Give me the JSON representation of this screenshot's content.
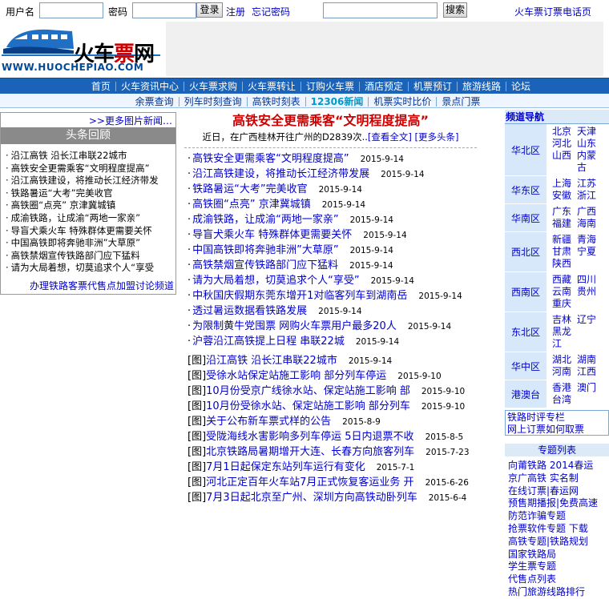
{
  "login": {
    "username_label": "用户名",
    "password_label": "密码",
    "login_button": "登录",
    "register": "注册",
    "forgot": "忘记密码",
    "search_button": "搜索",
    "hotline": "火车票订票电话页"
  },
  "logo": {
    "name_black": "火车",
    "name_red": "票",
    "name_black2": "网",
    "url": "WWW.HUOCHEPIAO.COM"
  },
  "nav_main": [
    "首页",
    "火车资讯中心",
    "火车票求购",
    "火车票转让",
    "订购火车票",
    "酒店预定",
    "机票预订",
    "旅游线路",
    "论坛"
  ],
  "nav_sub": [
    "余票查询",
    "列车时刻查询",
    "高铁时刻表",
    "12306新闻",
    "机票实时比价",
    "景点门票"
  ],
  "left": {
    "more_pics": ">>更多图片新闻…",
    "title": "头条回顾",
    "items": [
      "沿江高铁 沿长江串联22城市",
      "高铁安全更需乘客“文明程度提高”",
      "沿江高铁建设，将推动长江经济带发",
      "铁路暑运“大考”完美收官",
      "高铁圈“点亮” 京津冀城镇",
      "成渝铁路，让成渝“两地一家亲”",
      "导盲犬乘火车 特殊群体更需要关怀",
      "中国高铁即将奔驰非洲”大草原”",
      "高铁禁烟宣传铁路部门应下猛料",
      "请为大局着想，切莫追求个人“享受"
    ],
    "footer": "办理铁路客票代售点加盟讨论频道"
  },
  "headline": {
    "title": "高铁安全更需乘客“文明程度提高”",
    "summary": "近日，在广西桂林开往广州的D2839次..",
    "full": "[查看全文]",
    "more": "[更多头条]"
  },
  "news": [
    {
      "title": "高铁安全更需乘客“文明程度提高”",
      "date": "2015-9-14"
    },
    {
      "title": "沿江高铁建设，将推动长江经济带发展",
      "date": "2015-9-14"
    },
    {
      "title": "铁路暑运“大考”完美收官",
      "date": "2015-9-14"
    },
    {
      "title": "高铁圈“点亮” 京津冀城镇",
      "date": "2015-9-14"
    },
    {
      "title": "成渝铁路，让成渝“两地一家亲”",
      "date": "2015-9-14"
    },
    {
      "title": "导盲犬乘火车 特殊群体更需要关怀",
      "date": "2015-9-14"
    },
    {
      "title": "中国高铁即将奔驰非洲”大草原”",
      "date": "2015-9-14"
    },
    {
      "title": "高铁禁烟宣传铁路部门应下猛料",
      "date": "2015-9-14"
    },
    {
      "title": "请为大局着想，切莫追求个人“享受”",
      "date": "2015-9-14"
    },
    {
      "title": "中秋国庆假期东莞东增开1对临客列车到湖南岳",
      "date": "2015-9-14"
    },
    {
      "title": "透过暑运数据看铁路发展",
      "date": "2015-9-14"
    },
    {
      "title": "为限制黄牛党囤票 网购火车票用户最多20人",
      "date": "2015-9-14"
    },
    {
      "title": "沪蓉沿江高铁提上日程 串联22城",
      "date": "2015-9-14"
    }
  ],
  "pic_news_prefix": "[图]",
  "pic_news": [
    {
      "title": "沿江高铁 沿长江串联22城市",
      "date": "2015-9-14"
    },
    {
      "title": "受徐水站保定站施工影响 部分列车停运",
      "date": "2015-9-10"
    },
    {
      "title": "10月份受京广线徐水站、保定站施工影响 部",
      "date": "2015-9-10"
    },
    {
      "title": "10月份受徐水站、保定站施工影响 部分列车",
      "date": "2015-9-10"
    },
    {
      "title": "关于公布新车票式样的公告",
      "date": "2015-8-9"
    },
    {
      "title": "受陇海线水害影响多列车停运 5日内退票不收",
      "date": "2015-8-5"
    },
    {
      "title": "北京铁路局暑期增开大连、长春方向旅客列车",
      "date": "2015-7-23"
    },
    {
      "title": "7月1日起保定东站列车运行有变化",
      "date": "2015-7-1"
    },
    {
      "title": "河北正定百年火车站7月正式恢复客运业务 开",
      "date": "2015-6-26"
    },
    {
      "title": "7月3日起北京至广州、深圳方向高铁动卧列车",
      "date": "2015-6-4"
    }
  ],
  "channel": {
    "title": "频道导航",
    "regions": [
      {
        "name": "华北区",
        "cities": [
          "北京",
          "天津",
          "河北",
          "山东",
          "山西",
          "内蒙古"
        ]
      },
      {
        "name": "华东区",
        "cities": [
          "上海",
          "江苏",
          "安徽",
          "浙江"
        ]
      },
      {
        "name": "华南区",
        "cities": [
          "广东",
          "广西",
          "福建",
          "海南"
        ]
      },
      {
        "name": "西北区",
        "cities": [
          "新疆",
          "青海",
          "甘肃",
          "宁夏",
          "陕西"
        ]
      },
      {
        "name": "西南区",
        "cities": [
          "西藏",
          "四川",
          "云南",
          "贵州",
          "重庆"
        ]
      },
      {
        "name": "东北区",
        "cities": [
          "吉林",
          "辽宁",
          "黑龙江"
        ]
      },
      {
        "name": "华中区",
        "cities": [
          "湖北",
          "湖南",
          "河南",
          "江西"
        ]
      },
      {
        "name": "港澳台",
        "cities": [
          "香港",
          "澳门",
          "台湾"
        ]
      }
    ],
    "links": [
      "铁路时评专栏",
      "网上订票如何取票"
    ]
  },
  "topics": {
    "title": "专题列表",
    "items": [
      "向莆铁路 2014春运",
      "京广高铁 实名制",
      "在线订票|春运网",
      "预售期播报|免费高速",
      "防范诈骗专题",
      "抢票软件专题 下载",
      "高铁专题|铁路规划",
      "国家铁路局",
      "学生票专题",
      "代售点列表",
      "热门旅游线路排行"
    ]
  }
}
